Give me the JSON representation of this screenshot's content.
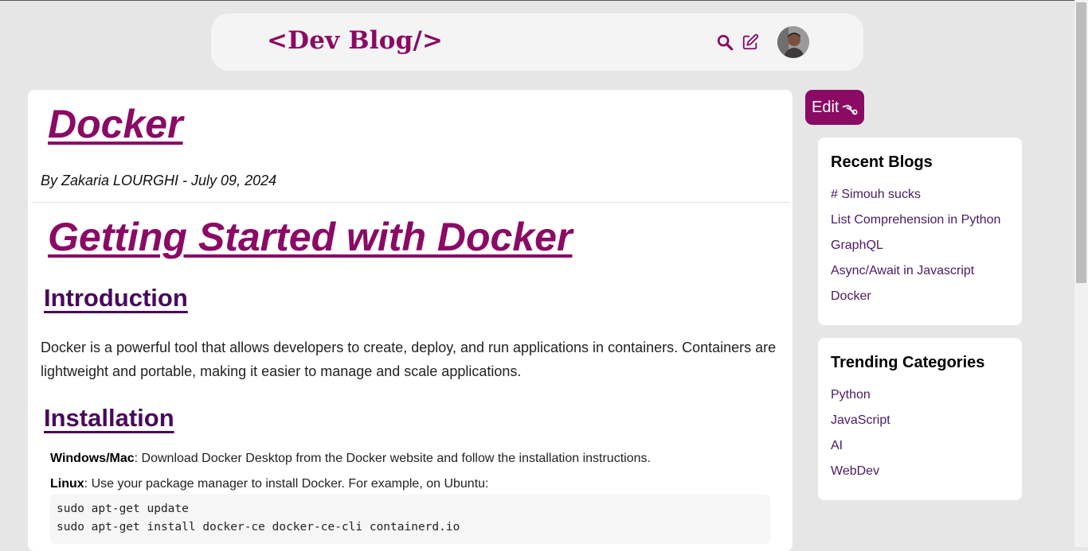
{
  "header": {
    "brand": "<Dev Blog/>",
    "icons": {
      "search": "search-icon",
      "write": "pencil-square-icon"
    },
    "avatar_alt": "user avatar"
  },
  "post": {
    "title": "Docker",
    "byline": "By Zakaria LOURGHI - July 09, 2024",
    "h1": "Getting Started with Docker",
    "sections": {
      "intro_heading": "Introduction",
      "intro_text": "Docker is a powerful tool that allows developers to create, deploy, and run applications in containers. Containers are lightweight and portable, making it easier to manage and scale applications.",
      "install_heading": "Installation",
      "install_items": [
        {
          "label": "Windows/Mac",
          "text": ": Download Docker Desktop from the Docker website and follow the installation instructions."
        },
        {
          "label": "Linux",
          "text": ": Use your package manager to install Docker. For example, on Ubuntu:"
        }
      ],
      "code_lines": [
        "sudo apt-get update",
        "sudo apt-get install docker-ce docker-ce-cli containerd.io"
      ]
    }
  },
  "edit_button": {
    "label": "Edit",
    "icon": "wrench-hand-icon"
  },
  "recent_blogs": {
    "title": "Recent Blogs",
    "items": [
      "# Simouh sucks",
      "List Comprehension in Python",
      "GraphQL",
      "Async/Await in Javascript",
      "Docker"
    ]
  },
  "trending": {
    "title": "Trending Categories",
    "items": [
      "Python",
      "JavaScript",
      "AI",
      "WebDev"
    ]
  },
  "colors": {
    "brand": "#8a0a64",
    "heading": "#470a5a",
    "link": "#4b1a62",
    "background": "#e6e6e6"
  }
}
